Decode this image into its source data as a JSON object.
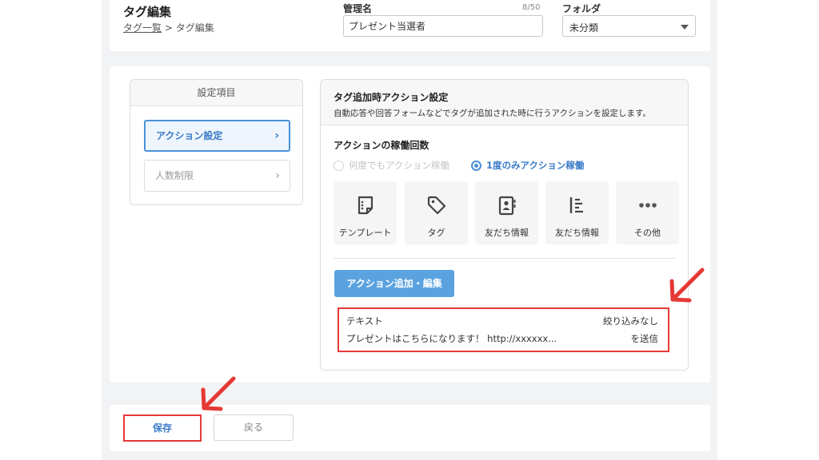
{
  "header": {
    "title": "タグ編集",
    "breadcrumb": {
      "link": "タグ一覧",
      "separator": " > ",
      "current": "タグ編集"
    },
    "name_field": {
      "label": "管理名",
      "value": "プレゼント当選者",
      "counter": "8/50"
    },
    "folder_field": {
      "label": "フォルダ",
      "value": "未分類"
    }
  },
  "settings": {
    "heading": "設定項目",
    "items": [
      {
        "label": "アクション設定",
        "chevron": "›"
      },
      {
        "label": "人数制限",
        "chevron": "›"
      }
    ]
  },
  "action_settings": {
    "title": "タグ追加時アクション設定",
    "description": "自動応答や回答フォームなどでタグが追加された時に行うアクションを設定します。",
    "run_count_label": "アクションの稼働回数",
    "run_options": [
      {
        "label": "何度でもアクション稼働",
        "selected": false,
        "disabled": true
      },
      {
        "label": "1度のみアクション稼働",
        "selected": true,
        "disabled": false
      }
    ],
    "tiles": [
      {
        "label": "テンプレート",
        "icon": "template-icon"
      },
      {
        "label": "タグ",
        "icon": "tag-icon"
      },
      {
        "label": "友だち情報",
        "icon": "contact-card-icon"
      },
      {
        "label": "友だち情報",
        "icon": "list-icon"
      },
      {
        "label": "その他",
        "icon": "more-icon"
      }
    ],
    "add_button": "アクション追加・編集",
    "result": {
      "type": "テキスト",
      "filter": "絞り込みなし",
      "message": "プレゼントはこちらになります！ http://xxxxxx...",
      "send": "を送信"
    }
  },
  "footer": {
    "save_label": "保存",
    "back_label": "戻る"
  },
  "colors": {
    "accent": "#4a90d9",
    "highlight": "#e53935",
    "page_background": "#f2f3f5"
  }
}
